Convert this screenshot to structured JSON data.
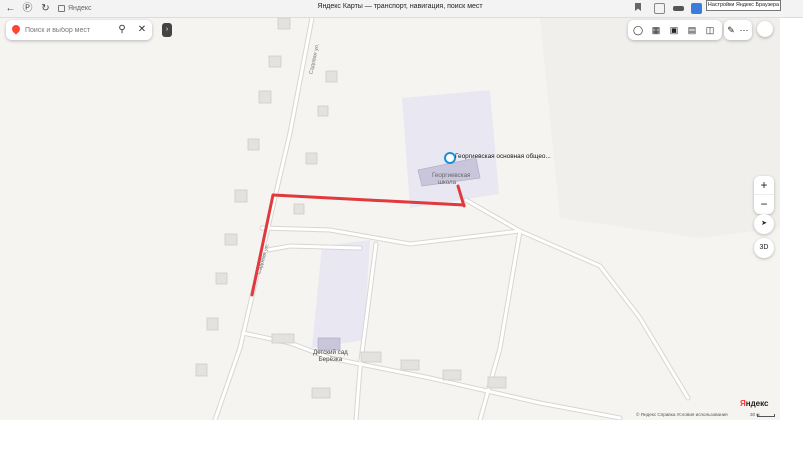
{
  "browser": {
    "site_label": "Яндекс",
    "page_title": "Яндекс Карты — транспорт, навигация, поиск мест",
    "settings_tooltip": "Настройки Яндекс Браузера"
  },
  "search": {
    "placeholder": "Поиск и выбор мест"
  },
  "map": {
    "poi_title": "Георгиевская основная общео...",
    "school_label_line1": "Георгиевская",
    "school_label_line2": "школа",
    "kindergarten_line1": "Детский сад",
    "kindergarten_line2": "Берёзка",
    "street_upper": "Садовая ул.",
    "street_lower": "Садовая ул.",
    "route_color": "#e0393e"
  },
  "controls": {
    "zoom_in": "+",
    "zoom_out": "−",
    "mode_3d": "3D"
  },
  "footer": {
    "copyright": "© Яндекс  Справка  Условия использования",
    "scale": "30 м",
    "logo_prefix": "Я",
    "logo_rest": "ндекс"
  }
}
